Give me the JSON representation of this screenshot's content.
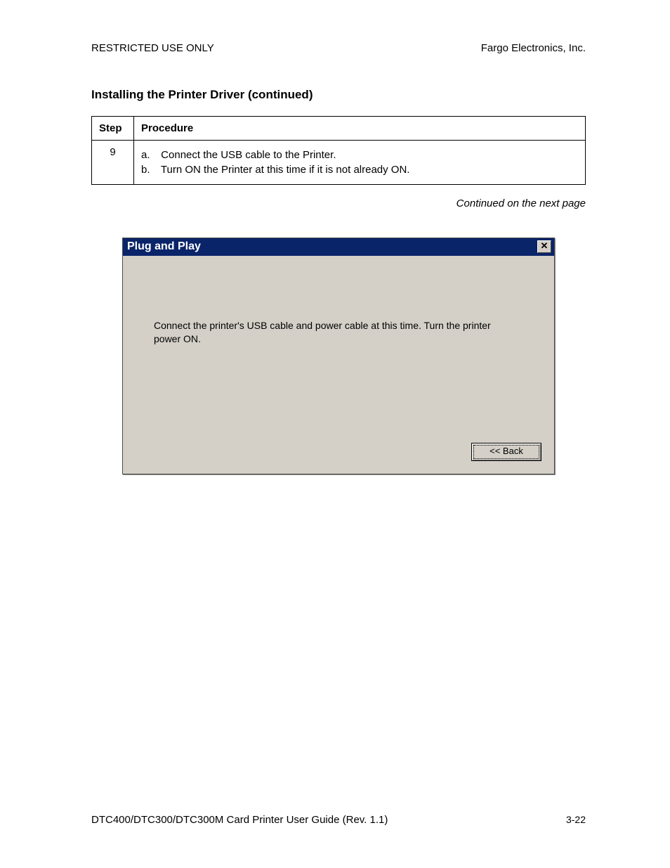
{
  "header": {
    "left": "RESTRICTED USE ONLY",
    "right": "Fargo Electronics, Inc."
  },
  "section_title": "Installing the Printer Driver (continued)",
  "table": {
    "headers": {
      "step": "Step",
      "procedure": "Procedure"
    },
    "rows": [
      {
        "step": "9",
        "items": [
          {
            "letter": "a.",
            "text": "Connect the USB cable to the Printer."
          },
          {
            "letter": "b.",
            "text": "Turn ON the Printer at this time if it is not already ON."
          }
        ]
      }
    ]
  },
  "continued_text": "Continued on the next page",
  "dialog": {
    "title": "Plug and Play",
    "close_glyph": "✕",
    "body_text": "Connect the printer's USB cable and power cable at this time.  Turn the printer power ON.",
    "back_label": "<< Back"
  },
  "footer": {
    "left": "DTC400/DTC300/DTC300M Card Printer User Guide (Rev. 1.1)",
    "right": "3-22"
  }
}
